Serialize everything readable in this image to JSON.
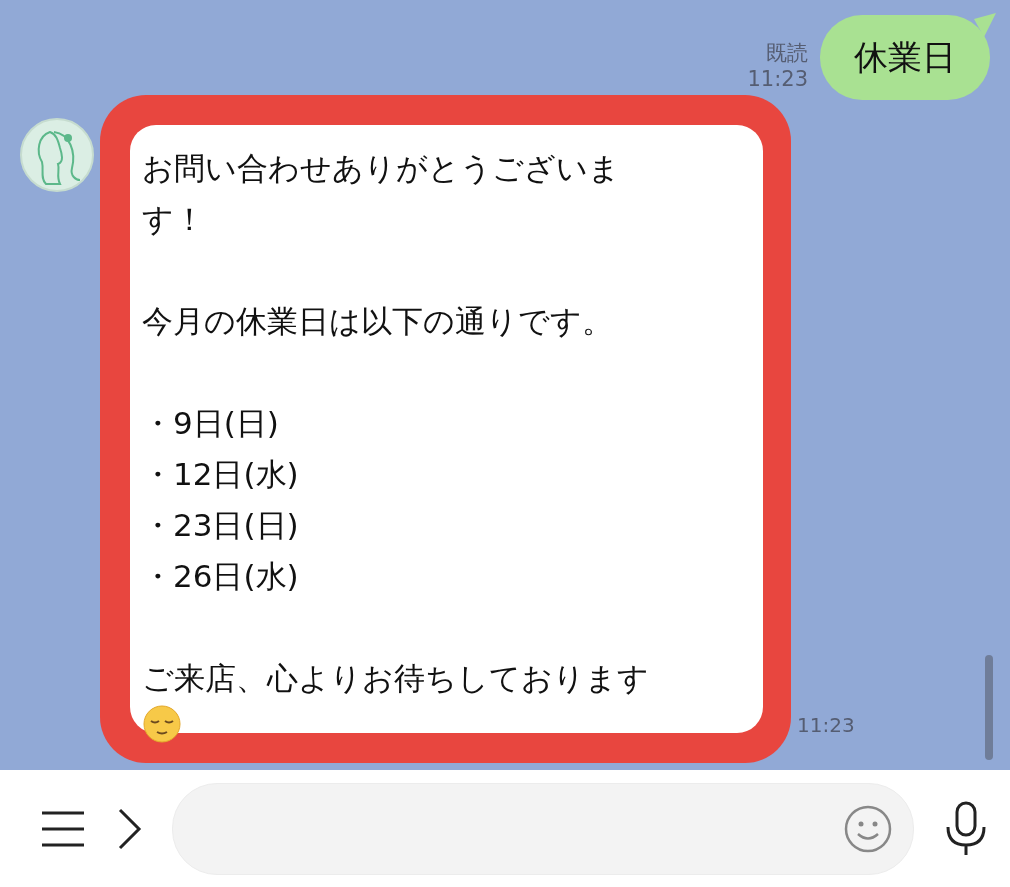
{
  "sent_message": {
    "text": "休業日",
    "read_label": "既読",
    "time": "11:23"
  },
  "received_message": {
    "paragraphs": [
      [
        "お問い合わせありがとうございま",
        "す！"
      ],
      [
        "今月の休業日は以下の通りです。"
      ],
      [
        "・9日(日)",
        "・12日(水)",
        "・23日(日)",
        "・26日(水)"
      ],
      [
        "ご来店、心よりお待ちしております"
      ]
    ],
    "time": "11:23"
  }
}
